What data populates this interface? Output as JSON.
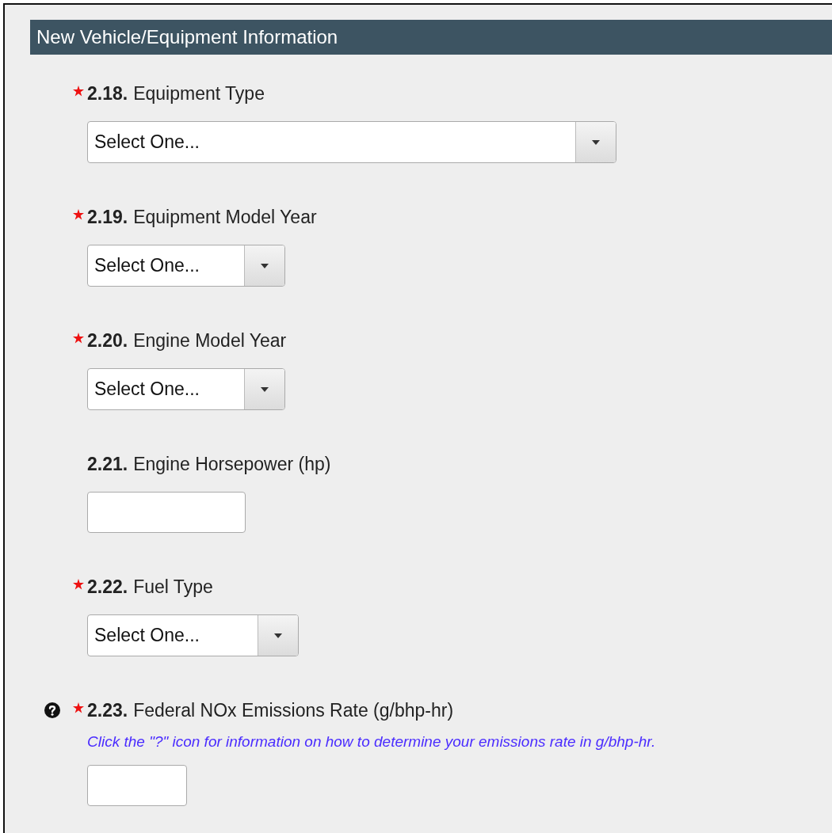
{
  "section": {
    "title": "New Vehicle/Equipment Information"
  },
  "fields": [
    {
      "kind": "select",
      "number": "2.18.",
      "label": "Equipment Type",
      "required": true,
      "help": false,
      "value": "Select One..."
    },
    {
      "kind": "select",
      "number": "2.19.",
      "label": "Equipment Model Year",
      "required": true,
      "help": false,
      "value": "Select One..."
    },
    {
      "kind": "select",
      "number": "2.20.",
      "label": "Engine Model Year",
      "required": true,
      "help": false,
      "value": "Select One..."
    },
    {
      "kind": "text",
      "number": "2.21.",
      "label": "Engine Horsepower (hp)",
      "required": false,
      "help": false
    },
    {
      "kind": "select",
      "number": "2.22.",
      "label": "Fuel Type",
      "required": true,
      "help": false,
      "value": "Select One..."
    },
    {
      "kind": "text",
      "number": "2.23.",
      "label": "Federal NOx Emissions Rate (g/bhp-hr)",
      "required": true,
      "help": true,
      "hint": "Click the \"?\" icon for information on how to determine your emissions rate in g/bhp-hr."
    }
  ]
}
